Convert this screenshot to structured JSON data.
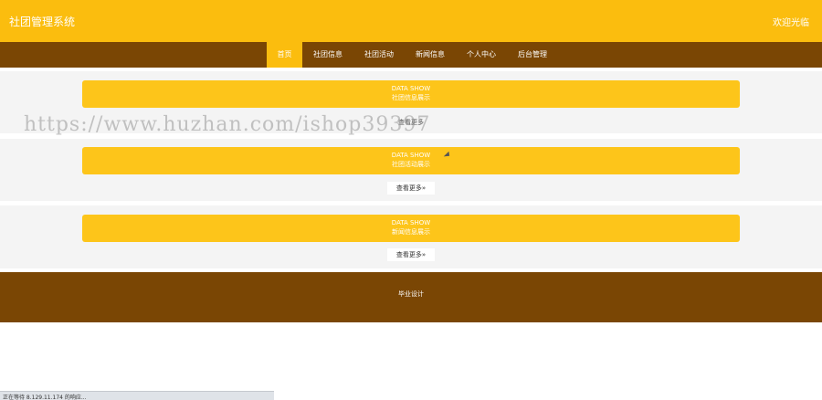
{
  "header": {
    "title": "社团管理系统",
    "welcome": "欢迎光临"
  },
  "nav": {
    "items": [
      "首页",
      "社团信息",
      "社团活动",
      "新闻信息",
      "个人中心",
      "后台管理"
    ],
    "active_index": 0
  },
  "sections": [
    {
      "en": "DATA SHOW",
      "cn": "社团信息展示",
      "more": "查看更多"
    },
    {
      "en": "DATA SHOW",
      "cn": "社团活动展示",
      "more": "查看更多»"
    },
    {
      "en": "DATA SHOW",
      "cn": "新闻信息展示",
      "more": "查看更多»"
    }
  ],
  "watermark": "https://www.huzhan.com/ishop39397",
  "footer": {
    "text": "毕业设计"
  },
  "status": {
    "text": "正在等待 8.129.11.174 的响应..."
  },
  "colors": {
    "primary": "#fbbd0e",
    "banner": "#fdc51a",
    "nav": "#7a4604",
    "section_bg": "#f4f4f4"
  },
  "icons": [
    "cursor-icon",
    "double-chevron-right-icon"
  ]
}
